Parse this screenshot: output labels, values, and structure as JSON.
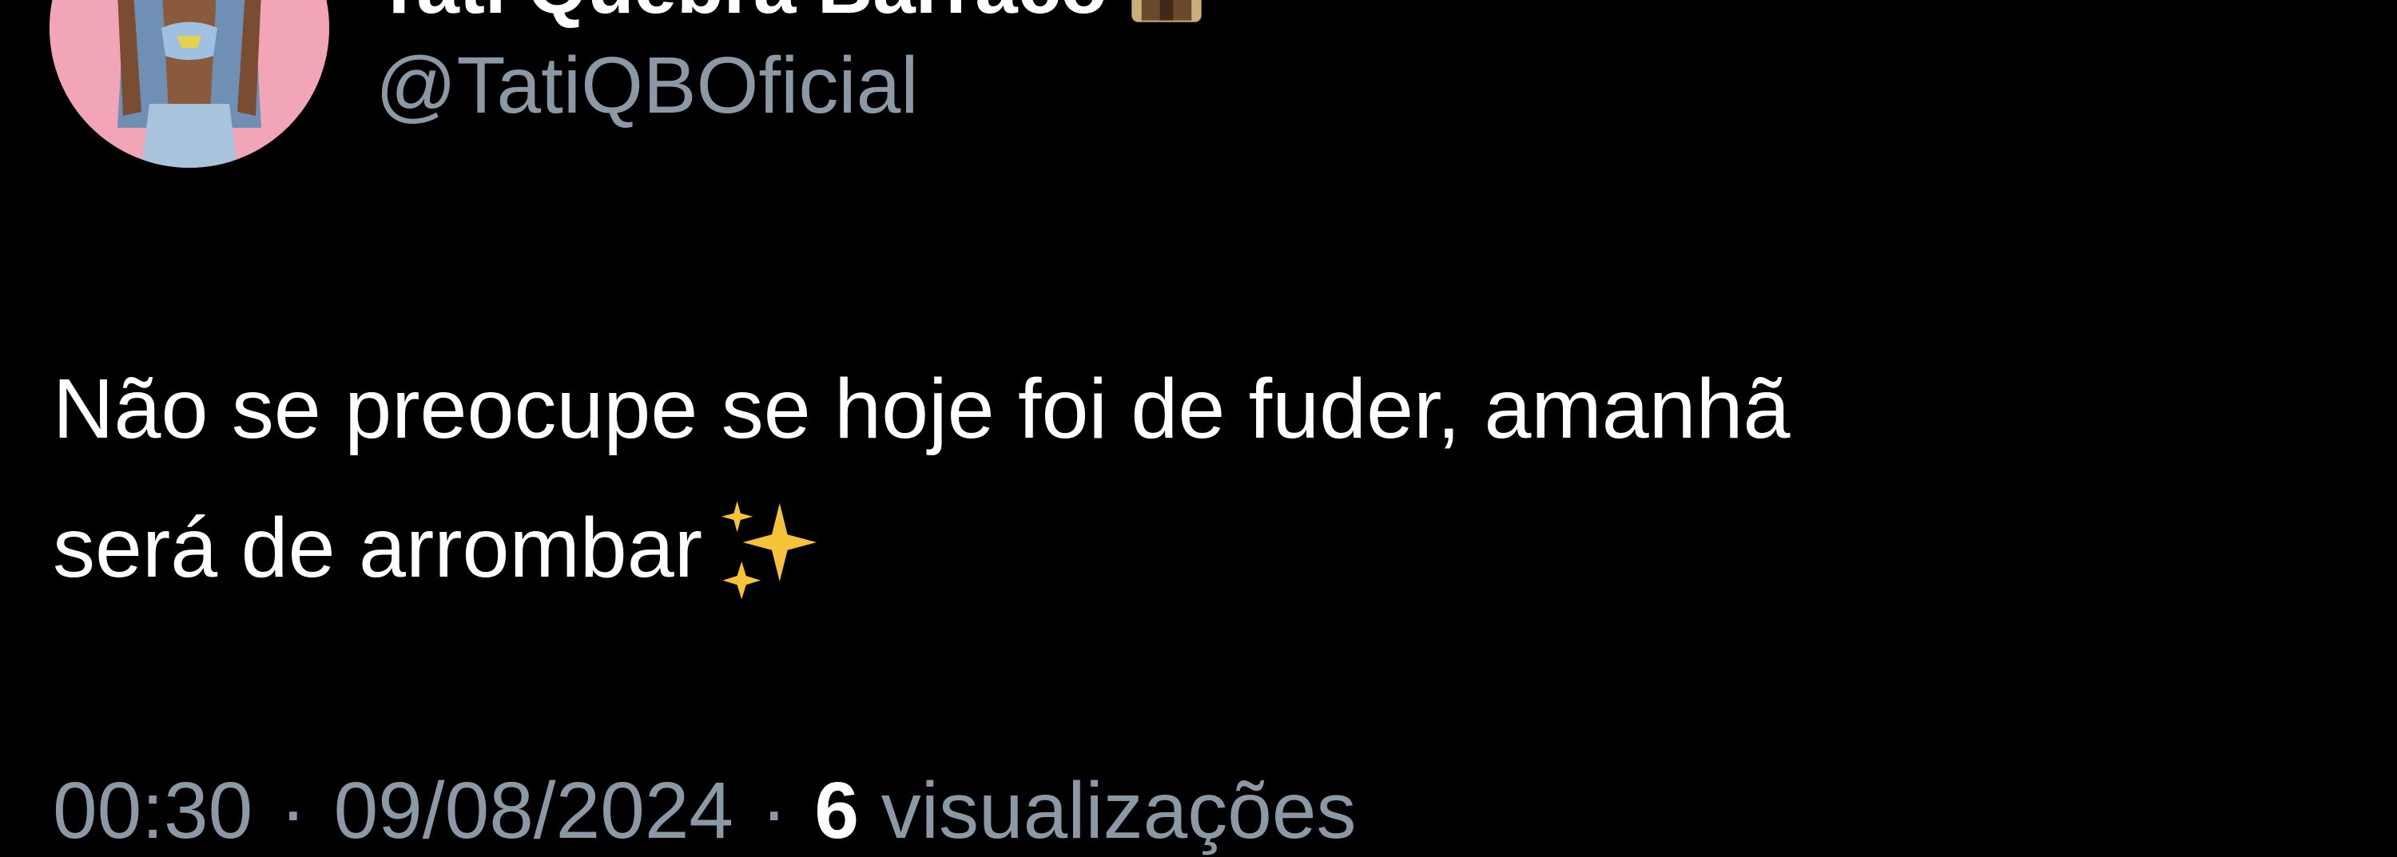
{
  "author": {
    "display_name": "Tati Quebra Barraco",
    "handle": "@TatiQBOficial",
    "avatar": "avatar",
    "name_emoji": "brown-house-icon"
  },
  "tweet": {
    "text_line1": "Não se preocupe se hoje foi de fuder, amanhã",
    "text_line2": "será de arrombar",
    "emoji": "sparkles-icon"
  },
  "meta": {
    "time": "00:30",
    "separator": "·",
    "date": "09/08/2024",
    "views_count": "6",
    "views_label": "visualizações"
  },
  "colors": {
    "background": "#000000",
    "text": "#ffffff",
    "secondary_text": "#8b98a5",
    "avatar_bg": "#f2a5b6"
  }
}
